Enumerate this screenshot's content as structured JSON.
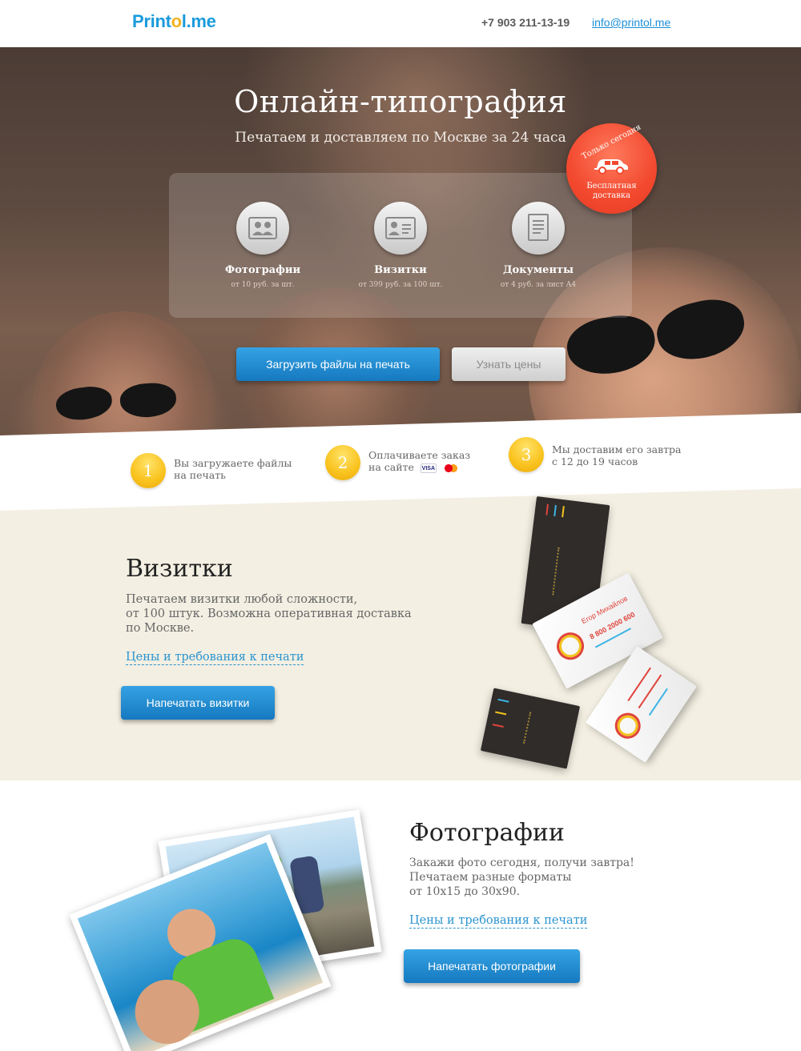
{
  "header": {
    "logo_pre": "Print",
    "logo_o": "o",
    "logo_post": "l.me",
    "phone": "+7 903 211-13-19",
    "email": "info@printol.me"
  },
  "hero": {
    "title": "Онлайн-типография",
    "subtitle": "Печатаем и доставляем по Москве за 24 часа",
    "services": [
      {
        "name": "Фотографии",
        "price": "от 10 руб. за шт.",
        "icon": "photo-icon"
      },
      {
        "name": "Визитки",
        "price": "от 399 руб. за 100 шт.",
        "icon": "business-card-icon"
      },
      {
        "name": "Документы",
        "price": "от 4 руб. за лист А4",
        "icon": "document-icon"
      }
    ],
    "badge": {
      "top": "Только сегодня",
      "line1": "Бесплатная",
      "line2": "доставка",
      "icon": "car-icon"
    },
    "upload_button": "Загрузить файлы на печать",
    "prices_button": "Узнать цены"
  },
  "steps": [
    {
      "num": "1",
      "line1": "Вы загружаете файлы",
      "line2": "на печать"
    },
    {
      "num": "2",
      "line1": "Оплачиваете заказ",
      "line2": "на сайте",
      "cards": [
        "VISA",
        "MC"
      ]
    },
    {
      "num": "3",
      "line1": "Мы доставим его завтра",
      "line2": "с 12 до 19 часов"
    }
  ],
  "cards_section": {
    "title": "Визитки",
    "line1": "Печатаем визитки любой сложности,",
    "line2": "от 100 штук. Возможна оперативная доставка",
    "line3": "по Москве.",
    "link": "Цены и требования к печати",
    "button": "Напечатать визитки",
    "card_name": "Егор Михайлов",
    "card_phone": "8 800 2000 600"
  },
  "photos_section": {
    "title": "Фотографии",
    "line1": "Закажи фото сегодня, получи завтра!",
    "line2": "Печатаем разные форматы",
    "line3": "от 10х15 до 30х90.",
    "link": "Цены и требования к печати",
    "button": "Напечатать фотографии"
  },
  "colors": {
    "brand_blue": "#1a9bdc",
    "accent_yellow": "#f9c21c",
    "badge_red": "#f2492f",
    "beige": "#f3efe2"
  }
}
